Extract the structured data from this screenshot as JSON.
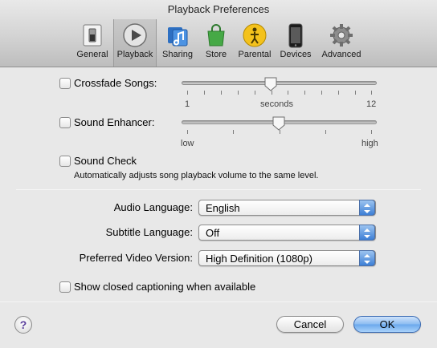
{
  "window": {
    "title": "Playback Preferences"
  },
  "toolbar": {
    "items": [
      {
        "label": "General",
        "icon": "switch-icon"
      },
      {
        "label": "Playback",
        "icon": "play-icon",
        "selected": true
      },
      {
        "label": "Sharing",
        "icon": "music-folder-icon"
      },
      {
        "label": "Store",
        "icon": "shopping-bag-icon"
      },
      {
        "label": "Parental",
        "icon": "parental-icon"
      },
      {
        "label": "Devices",
        "icon": "iphone-icon"
      },
      {
        "label": "Advanced",
        "icon": "gear-icon"
      }
    ]
  },
  "crossfade": {
    "label": "Crossfade Songs:",
    "checked": false,
    "min_label": "1",
    "mid_label": "seconds",
    "max_label": "12",
    "value": 6
  },
  "enhancer": {
    "label": "Sound Enhancer:",
    "checked": false,
    "min_label": "low",
    "max_label": "high",
    "level": 0.5
  },
  "sound_check": {
    "label": "Sound Check",
    "checked": false,
    "description": "Automatically adjusts song playback volume to the same level."
  },
  "audio_language": {
    "label": "Audio Language:",
    "value": "English"
  },
  "subtitle_language": {
    "label": "Subtitle Language:",
    "value": "Off"
  },
  "video_version": {
    "label": "Preferred Video Version:",
    "value": "High Definition (1080p)"
  },
  "closed_captioning": {
    "label": "Show closed captioning when available",
    "checked": false
  },
  "buttons": {
    "cancel": "Cancel",
    "ok": "OK",
    "help": "?"
  },
  "colors": {
    "accent": "#6aa7ec",
    "help_glyph": "#5a3e9c"
  }
}
